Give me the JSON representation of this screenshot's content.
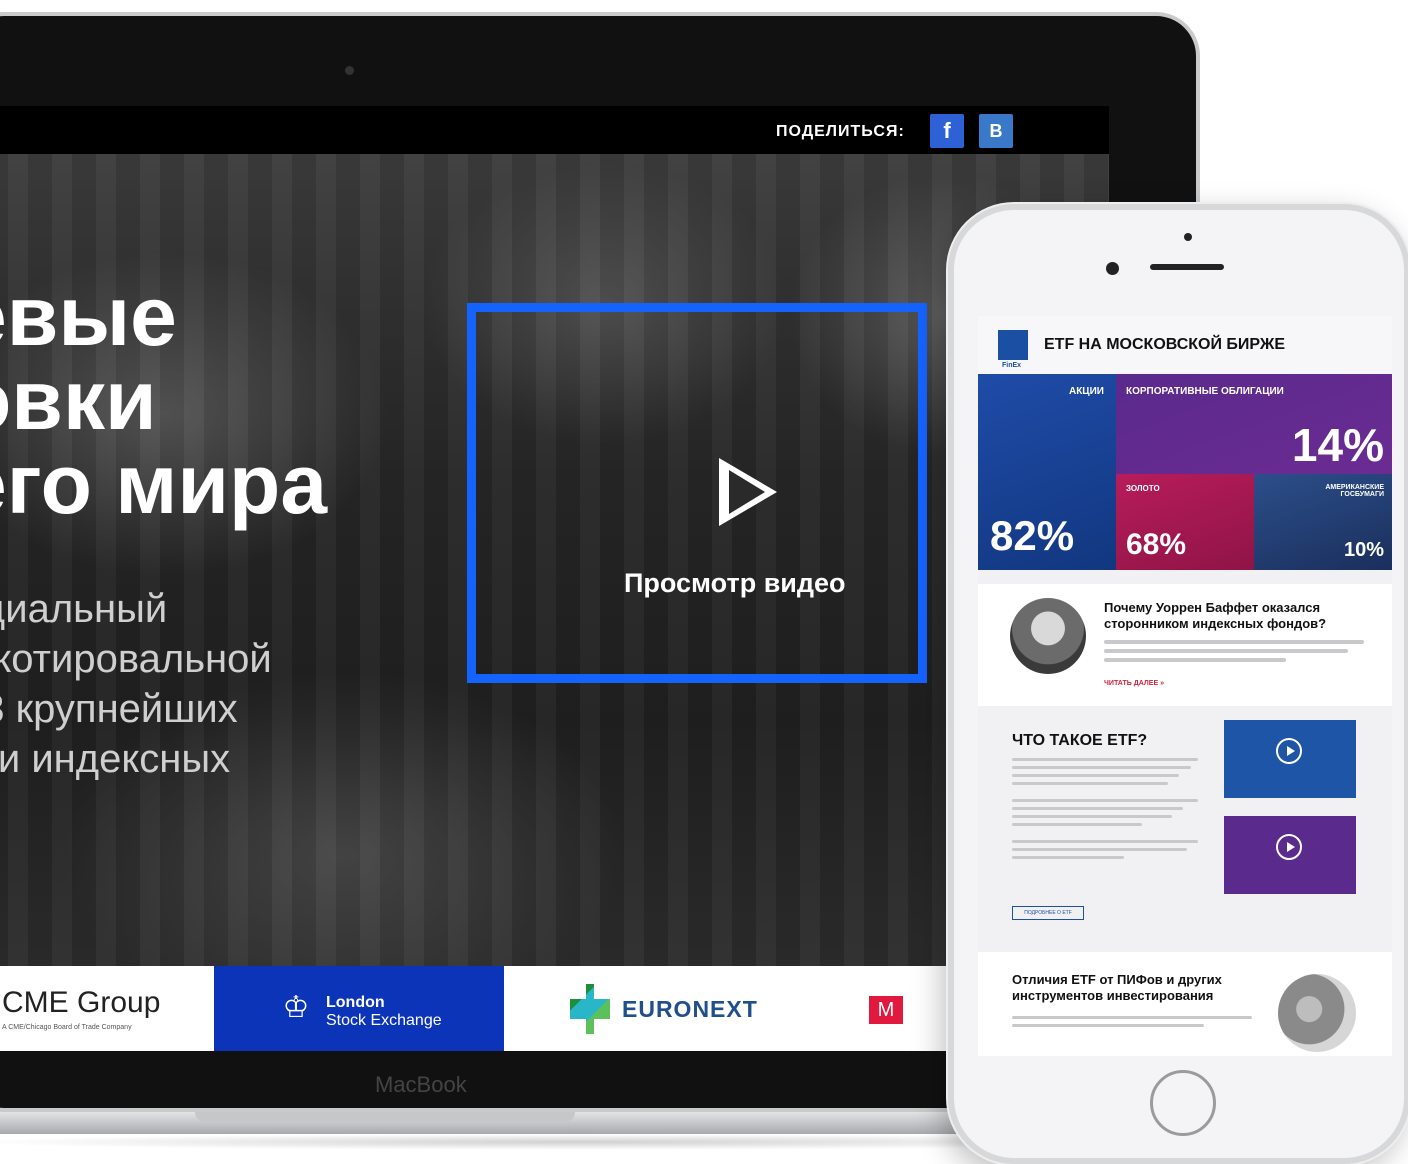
{
  "laptop": {
    "brand": "MacBook",
    "share": {
      "label": "ПОДЕЛИТЬСЯ:",
      "facebook": "f",
      "vk": "B"
    },
    "hero": {
      "title_lines": [
        "евые",
        "овки",
        "его мира"
      ],
      "subtitle_lines": [
        "ициальный",
        "о котировальной",
        "13 крупнейших",
        "ж и индексных"
      ],
      "video_label": "Просмотр видео"
    },
    "logos": {
      "cme_name": "CME Group",
      "cme_sub": "A CME/Chicago Board of Trade Company",
      "lse_line1": "London",
      "lse_line2": "Stock Exchange",
      "euronext": "EURONEXT",
      "moex": "M"
    }
  },
  "phone": {
    "header": {
      "title": "ETF НА МОСКОВСКОЙ БИРЖЕ",
      "logo_text": "FinEx"
    },
    "tiles": {
      "stocks_label": "АКЦИИ",
      "stocks_value": "82%",
      "corp_label": "КОРПОРАТИВНЫЕ ОБЛИГАЦИИ",
      "corp_value": "14%",
      "gold_label": "ЗОЛОТО",
      "gold_value": "68%",
      "treas_label": "АМЕРИКАНСКИЕ ГОСБУМАГИ",
      "treas_value": "10%"
    },
    "article1": {
      "title": "Почему Уоррен Баффет оказался сторонником индексных фондов?",
      "read_more": "ЧИТАТЬ ДАЛЕЕ »"
    },
    "etf": {
      "title": "ЧТО ТАКОЕ ETF?",
      "button": "ПОДРОБНЕЕ О ETF"
    },
    "article2": {
      "title": "Отличия ETF от ПИФов и других инструментов инвестирования"
    }
  },
  "colors": {
    "accent_blue": "#1563ff",
    "facebook": "#2f61d6",
    "vk": "#3a79c9",
    "lse_blue": "#0b34b8",
    "euronext_text": "#1f4f8c",
    "moex_red": "#e2193e",
    "tile_blue": "#1f4ca8",
    "tile_purple": "#5a2a8d",
    "tile_magenta": "#b81c5b"
  }
}
